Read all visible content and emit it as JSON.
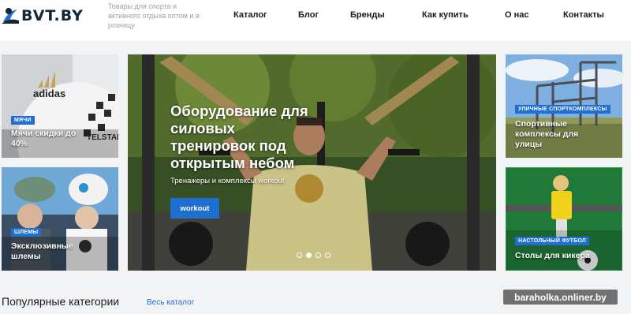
{
  "header": {
    "logo_text": "BVT.BY",
    "tagline": "Товары для спорта и активного отдыха оптом и в розницу",
    "nav": [
      "Каталог",
      "Блог",
      "Бренды",
      "Как купить",
      "О нас",
      "Контакты"
    ]
  },
  "tiles": {
    "balls": {
      "badge": "Мячи",
      "title": "Мячи скидки до 40%",
      "brand": "adidas",
      "ball_text": "TELSTAR"
    },
    "helmets": {
      "badge": "Шлемы",
      "title": "Эксклюзивные шлемы"
    },
    "street": {
      "badge": "Уличные спорткомплексы",
      "title": "Спортивные комплексы для улицы"
    },
    "kicker": {
      "badge": "Настольный футбол",
      "title": "Столы для кикера"
    }
  },
  "hero": {
    "title": "Оборудование для силовых тренировок под открытым небом",
    "subtitle": "Тренажеры и комплексы workout",
    "button": "workout",
    "slides_count": 4,
    "active_slide": 2
  },
  "categories": {
    "title": "Популярные категории",
    "all_link": "Весь каталог"
  },
  "watermark": "baraholka.onliner.by",
  "colors": {
    "accent": "#1e6fd0",
    "logo": "#15253a",
    "background": "#f2f3f5"
  }
}
